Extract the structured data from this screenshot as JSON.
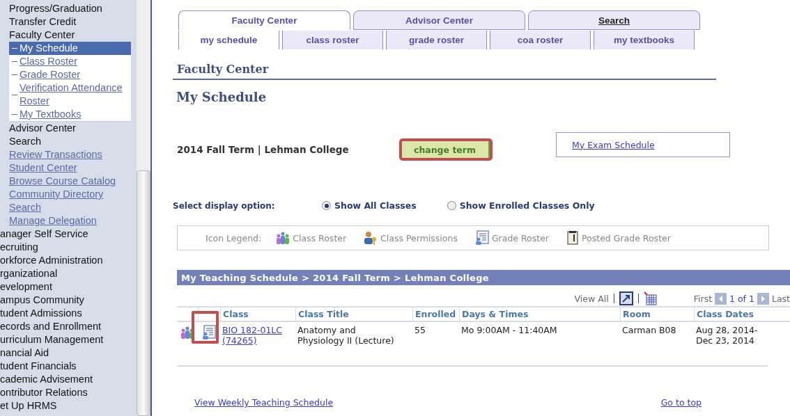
{
  "sidebar": {
    "items": [
      {
        "label": "Progress/Graduation",
        "kind": "text"
      },
      {
        "label": "Transfer Credit",
        "kind": "text"
      },
      {
        "label": "Faculty Center",
        "kind": "text",
        "children": [
          {
            "label": "My Schedule",
            "selected": true
          },
          {
            "label": "Class Roster",
            "selected": false
          },
          {
            "label": "Grade Roster",
            "selected": false
          },
          {
            "label": "Verification Attendance Roster",
            "selected": false
          },
          {
            "label": "My Textbooks",
            "selected": false
          }
        ]
      },
      {
        "label": "Advisor Center",
        "kind": "text"
      },
      {
        "label": "Search",
        "kind": "text"
      },
      {
        "label": "Review Transactions",
        "kind": "link"
      },
      {
        "label": "Student Center",
        "kind": "link"
      },
      {
        "label": "Browse Course Catalog",
        "kind": "link"
      },
      {
        "label": "Community Directory",
        "kind": "link"
      },
      {
        "label": "Search",
        "kind": "link"
      },
      {
        "label": "Manage Delegation",
        "kind": "link"
      },
      {
        "label": "anager Self Service",
        "kind": "clipped"
      },
      {
        "label": "ecruiting",
        "kind": "clipped"
      },
      {
        "label": "orkforce Administration",
        "kind": "clipped"
      },
      {
        "label": "rganizational",
        "kind": "clipped"
      },
      {
        "label": "evelopment",
        "kind": "clipped"
      },
      {
        "label": "ampus Community",
        "kind": "clipped"
      },
      {
        "label": "tudent Admissions",
        "kind": "clipped"
      },
      {
        "label": "ecords and Enrollment",
        "kind": "clipped"
      },
      {
        "label": "urriculum Management",
        "kind": "clipped"
      },
      {
        "label": "nancial Aid",
        "kind": "clipped"
      },
      {
        "label": "tudent Financials",
        "kind": "clipped"
      },
      {
        "label": "cademic Advisement",
        "kind": "clipped"
      },
      {
        "label": "ontributor Relations",
        "kind": "clipped"
      },
      {
        "label": "et Up HRMS",
        "kind": "clipped"
      }
    ]
  },
  "main_tabs": [
    {
      "label": "Faculty Center",
      "kind": "tab",
      "selected": true
    },
    {
      "label": "Advisor Center",
      "kind": "tab",
      "selected": false
    },
    {
      "label": "Search",
      "kind": "link",
      "selected": false
    }
  ],
  "sub_tabs": [
    {
      "label": "my schedule",
      "selected": true
    },
    {
      "label": "class roster",
      "selected": false
    },
    {
      "label": "grade roster",
      "selected": false
    },
    {
      "label": "coa roster",
      "selected": false
    },
    {
      "label": "my textbooks",
      "selected": false
    }
  ],
  "section_title": "Faculty Center",
  "page_title": "My Schedule",
  "term": "2014 Fall Term | Lehman College",
  "change_term": {
    "label": "change term",
    "highlighted": true
  },
  "exam_link": "My Exam Schedule",
  "display_option": {
    "label": "Select display option:",
    "options": [
      {
        "label": "Show All Classes",
        "selected": true
      },
      {
        "label": "Show Enrolled Classes Only",
        "selected": false
      }
    ]
  },
  "legend": {
    "label": "Icon Legend:",
    "items": [
      {
        "kind": "class-roster",
        "label": "Class Roster"
      },
      {
        "kind": "class-permissions",
        "label": "Class Permissions"
      },
      {
        "kind": "grade-roster",
        "label": "Grade Roster"
      },
      {
        "kind": "posted-grade-roster",
        "label": "Posted Grade Roster"
      }
    ]
  },
  "schedule": {
    "title": "My Teaching Schedule > 2014 Fall Term > Lehman College",
    "view_all": "View All",
    "pager": {
      "first": "First",
      "range": "1 of 1",
      "last": "Last"
    },
    "columns": [
      "Class",
      "Class Title",
      "Enrolled",
      "Days & Times",
      "Room",
      "Class Dates"
    ],
    "rows": [
      {
        "grade_roster_highlighted": true,
        "class": "BIO 182-01LC (74265)",
        "title": "Anatomy and Physiology II (Lecture)",
        "enrolled": "55",
        "days_times": "Mo 9:00AM - 11:40AM",
        "room": "Carman B08",
        "dates": "Aug 28, 2014-Dec 23, 2014"
      }
    ]
  },
  "footer": {
    "weekly": "View Weekly Teaching Schedule",
    "top": "Go to top"
  }
}
